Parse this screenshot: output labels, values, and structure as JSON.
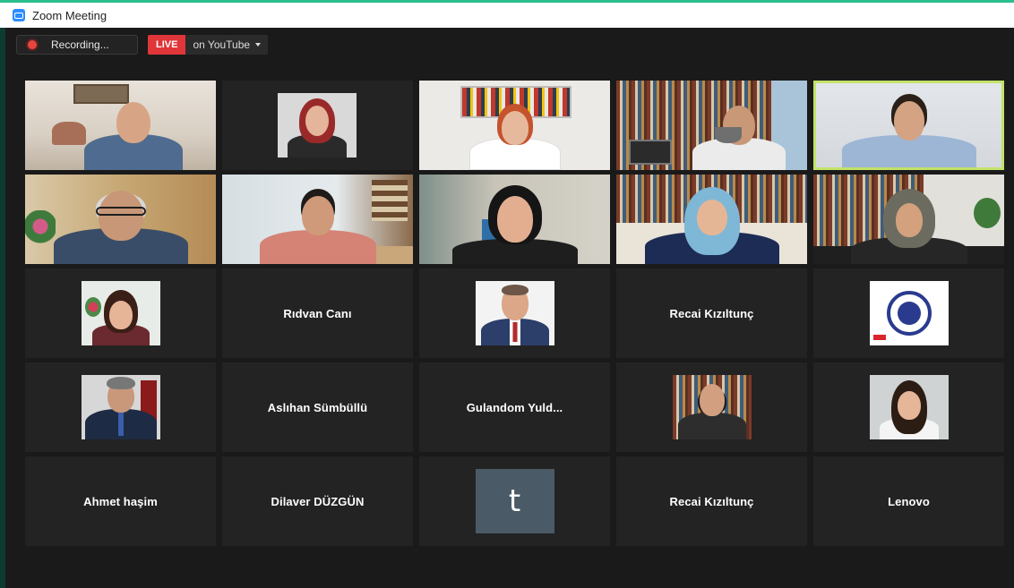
{
  "window": {
    "title": "Zoom Meeting"
  },
  "controls": {
    "recording_label": "Recording...",
    "live_label": "LIVE",
    "stream_label": "on YouTube"
  },
  "colors": {
    "active_speaker_border": "#c3e26a",
    "live_red": "#e0363a",
    "tile_bg": "#232323"
  },
  "participants": [
    {
      "kind": "video",
      "scene": "man-glasses-light-room"
    },
    {
      "kind": "video",
      "scene": "woman-red-hair-portrait"
    },
    {
      "kind": "video",
      "scene": "woman-bookshelf-white"
    },
    {
      "kind": "video",
      "scene": "man-beard-library"
    },
    {
      "kind": "video",
      "scene": "man-active-speaker",
      "active": true
    },
    {
      "kind": "video",
      "scene": "older-man-glasses-hand"
    },
    {
      "kind": "video",
      "scene": "man-pink-shirt-office"
    },
    {
      "kind": "video",
      "scene": "woman-dark-hair-office"
    },
    {
      "kind": "video",
      "scene": "woman-hijab-blue"
    },
    {
      "kind": "video",
      "scene": "woman-hijab-bookshelf"
    },
    {
      "kind": "photo",
      "thumb": "woman-photo"
    },
    {
      "kind": "name",
      "name": "Rıdvan Canı"
    },
    {
      "kind": "photo",
      "thumb": "man-suit-photo"
    },
    {
      "kind": "name",
      "name": "Recai Kızıltunç"
    },
    {
      "kind": "photo",
      "thumb": "university-seal-logo"
    },
    {
      "kind": "photo",
      "thumb": "man-suit-flag-photo"
    },
    {
      "kind": "name",
      "name": "Aslıhan Sümbüllü"
    },
    {
      "kind": "name",
      "name": "Gulandom  Yuld..."
    },
    {
      "kind": "photo",
      "thumb": "man-beard-bookshelf-photo"
    },
    {
      "kind": "photo",
      "thumb": "woman-long-hair-photo"
    },
    {
      "kind": "name",
      "name": "Ahmet haşim"
    },
    {
      "kind": "name",
      "name": "Dilaver DÜZGÜN"
    },
    {
      "kind": "initial",
      "initial": "t"
    },
    {
      "kind": "name",
      "name": "Recai Kızıltunç"
    },
    {
      "kind": "name",
      "name": "Lenovo"
    }
  ]
}
